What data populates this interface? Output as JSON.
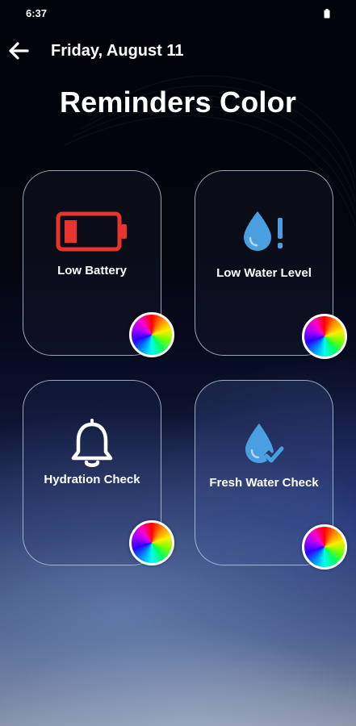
{
  "status_bar": {
    "time": "6:37"
  },
  "header": {
    "back_icon": "arrow-left-icon",
    "date": "Friday, August 11"
  },
  "page": {
    "title": "Reminders Color"
  },
  "cards": [
    {
      "label": "Low Battery",
      "icon": "low-battery-icon",
      "icon_color": "#e8342c"
    },
    {
      "label": "Low Water Level",
      "icon": "water-drop-alert-icon",
      "icon_color": "#4a9fe0"
    },
    {
      "label": "Hydration Check",
      "icon": "bell-icon",
      "icon_color": "#ffffff"
    },
    {
      "label": "Fresh Water Check",
      "icon": "water-drop-check-icon",
      "icon_color": "#4a9fe0"
    }
  ],
  "color_picker_icon": "color-wheel-icon"
}
